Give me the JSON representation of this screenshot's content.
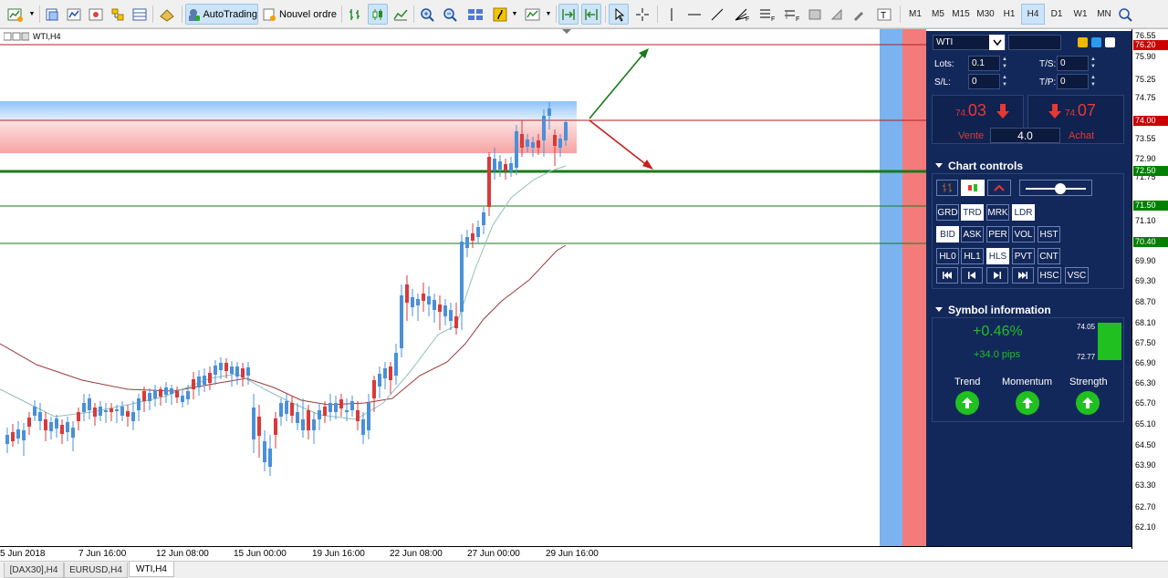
{
  "toolbar": {
    "autotrading_label": "AutoTrading",
    "new_order_label": "Nouvel ordre",
    "timeframes": [
      "M1",
      "M5",
      "M15",
      "M30",
      "H1",
      "H4",
      "D1",
      "W1",
      "MN"
    ],
    "active_timeframe": "H4"
  },
  "chart": {
    "window_label": "WTI,H4",
    "symbol": "WTI"
  },
  "price_axis": {
    "labels": [
      "76.55",
      "75.90",
      "75.25",
      "74.75",
      "73.55",
      "72.90",
      "71.75",
      "71.10",
      "70.40",
      "69.90",
      "69.30",
      "68.70",
      "68.10",
      "67.50",
      "66.90",
      "66.30",
      "65.70",
      "65.10",
      "64.50",
      "63.90",
      "63.30",
      "62.70",
      "62.10"
    ],
    "badges": [
      {
        "label": "76.20",
        "color": "#cc0000"
      },
      {
        "label": "74.00",
        "color": "#cc0000"
      },
      {
        "label": "72.50",
        "color": "#008000"
      },
      {
        "label": "71.50",
        "color": "#008000"
      },
      {
        "label": "70.40",
        "color": "#008000"
      }
    ]
  },
  "time_axis": {
    "labels": [
      "5 Jun 2018",
      "7 Jun 16:00",
      "12 Jun 08:00",
      "15 Jun 00:00",
      "19 Jun 16:00",
      "22 Jun 08:00",
      "27 Jun 00:00",
      "29 Jun 16:00"
    ]
  },
  "tabs": [
    {
      "label": "[DAX30],H4",
      "active": false
    },
    {
      "label": "EURUSD,H4",
      "active": false
    },
    {
      "label": "WTI,H4",
      "active": true
    }
  ],
  "panel": {
    "symbol": "WTI",
    "lots_label": "Lots:",
    "lots_value": "0.1",
    "sl_label": "S/L:",
    "sl_value": "0",
    "ts_label": "T/S:",
    "ts_value": "0",
    "tp_label": "T/P:",
    "tp_value": "0",
    "sell_small": "74.",
    "sell_big": "03",
    "buy_small": "74.",
    "buy_big": "07",
    "sell_label": "Vente",
    "buy_label": "Achat",
    "spread": "4.0",
    "chart_controls_title": "Chart controls",
    "buttons_row1": [
      "GRD",
      "TRD",
      "MRK",
      "LDR"
    ],
    "buttons_row2": [
      "BID",
      "ASK",
      "PER",
      "VOL",
      "HST"
    ],
    "buttons_row3": [
      "HL0",
      "HL1",
      "HLS",
      "PVT",
      "CNT"
    ],
    "nav_buttons": [
      "HSC",
      "VSC"
    ],
    "symbol_info_title": "Symbol information",
    "change_pct": "+0.46%",
    "change_pips": "+34.0 pips",
    "range_high": "74.05",
    "range_low": "72.77",
    "indicators": [
      "Trend",
      "Momentum",
      "Strength"
    ],
    "colors": {
      "bg": "#13285a",
      "sell": "#e53935",
      "green": "#20c020"
    }
  }
}
